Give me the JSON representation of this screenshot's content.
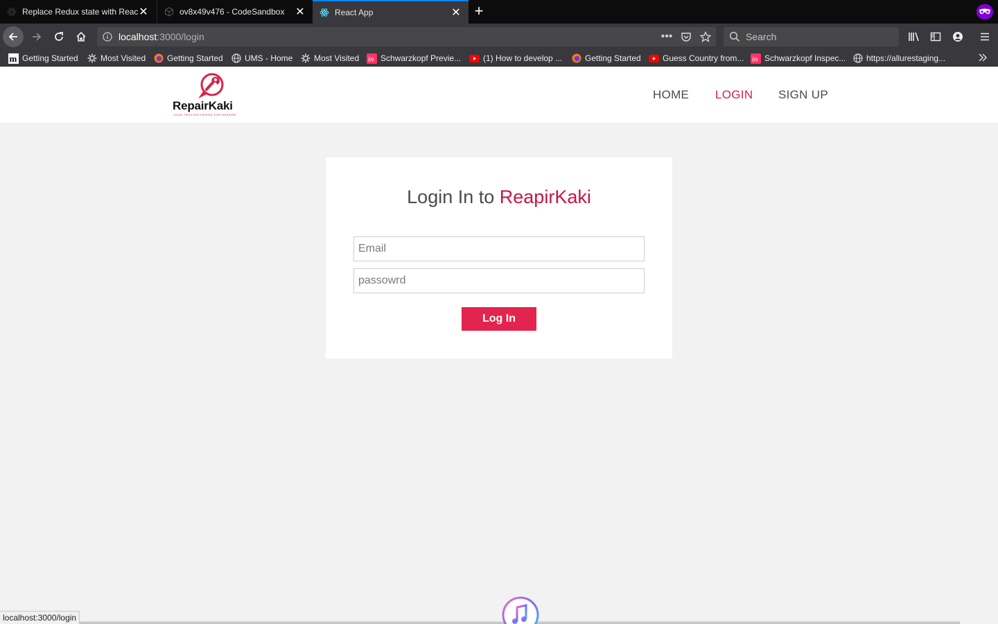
{
  "browser": {
    "tabs": [
      {
        "title": "Replace Redux state with React",
        "favicon": "react-dark-icon",
        "active": false
      },
      {
        "title": "ov8x49v476 - CodeSandbox",
        "favicon": "codesandbox-icon",
        "active": false
      },
      {
        "title": "React App",
        "favicon": "react-icon",
        "active": true
      }
    ],
    "url_host": "localhost",
    "url_path": ":3000/login",
    "search_placeholder": "Search",
    "bookmarks": [
      {
        "label": "Getting Started",
        "icon": "medium-icon"
      },
      {
        "label": "Most Visited",
        "icon": "gear-icon"
      },
      {
        "label": "Getting Started",
        "icon": "firefox-icon"
      },
      {
        "label": "UMS - Home",
        "icon": "globe-icon"
      },
      {
        "label": "Most Visited",
        "icon": "gear-icon"
      },
      {
        "label": "Schwarzkopf Previe...",
        "icon": "invision-icon"
      },
      {
        "label": "(1) How to develop ...",
        "icon": "youtube-icon"
      },
      {
        "label": "Getting Started",
        "icon": "firefox-icon"
      },
      {
        "label": "Guess Country from...",
        "icon": "youtube-icon"
      },
      {
        "label": "Schwarzkopf Inspec...",
        "icon": "invision-icon"
      },
      {
        "label": "https://allurestaging...",
        "icon": "globe-icon"
      }
    ],
    "status_text": "localhost:3000/login",
    "colors": {
      "chrome_dark": "#0c0c0d",
      "toolbar": "#38383d",
      "active_tab_accent": "#0a84ff",
      "private_mask": "#8000d7"
    }
  },
  "app": {
    "logo": {
      "brand": "RepairKaki",
      "tagline": "YOUR TRUSTED FRIEND FOR REPAIRS"
    },
    "nav": {
      "home": "HOME",
      "login": "LOGIN",
      "signup": "SIGN UP"
    },
    "login": {
      "heading_prefix": "Login In to",
      "heading_brand": "ReapirKaki",
      "email_placeholder": "Email",
      "password_placeholder": "passowrd",
      "button": "Log In"
    },
    "colors": {
      "accent": "#e3244f",
      "accent_text": "#c8153f",
      "page_bg": "#f2f2f2"
    }
  }
}
